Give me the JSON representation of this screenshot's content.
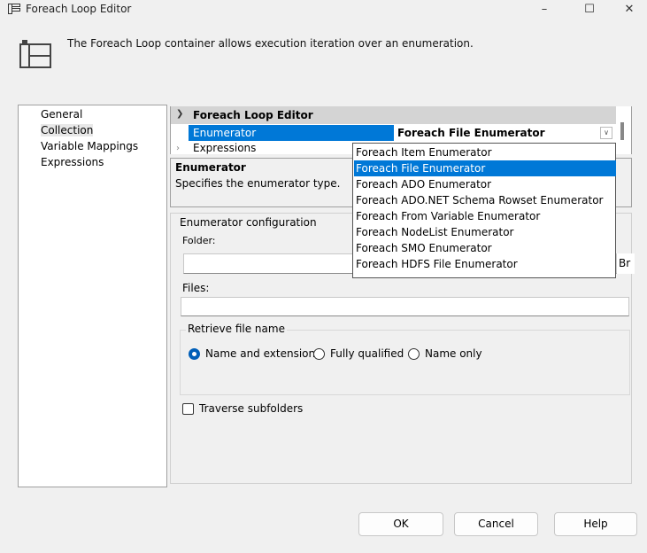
{
  "window": {
    "title": "Foreach Loop Editor",
    "minimize_glyph": "–",
    "maximize_glyph": "☐",
    "close_glyph": "✕"
  },
  "header": {
    "description": "The Foreach Loop container allows execution iteration over an enumeration."
  },
  "nav": {
    "items": [
      {
        "label": "General",
        "selected": false
      },
      {
        "label": "Collection",
        "selected": true
      },
      {
        "label": "Variable Mappings",
        "selected": false
      },
      {
        "label": "Expressions",
        "selected": false
      }
    ]
  },
  "property_grid": {
    "category": "Foreach Loop Editor",
    "rows": [
      {
        "name": "Enumerator",
        "value": "Foreach File Enumerator"
      },
      {
        "name": "Expressions",
        "value": ""
      }
    ]
  },
  "description_pane": {
    "title": "Enumerator",
    "text": "Specifies the enumerator type."
  },
  "config": {
    "title": "Enumerator configuration",
    "folder_label": "Folder:",
    "folder_value": "",
    "browse_label": "Br",
    "files_label": "Files:",
    "files_value": "",
    "retrieve_group_title": "Retrieve file name",
    "radio_options": [
      {
        "label": "Name and extension",
        "checked": true
      },
      {
        "label": "Fully qualified",
        "checked": false
      },
      {
        "label": "Name only",
        "checked": false
      }
    ],
    "traverse_label": "Traverse subfolders",
    "traverse_checked": false
  },
  "dropdown": {
    "items": [
      "Foreach Item Enumerator",
      "Foreach File Enumerator",
      "Foreach ADO Enumerator",
      "Foreach ADO.NET Schema Rowset Enumerator",
      "Foreach From Variable Enumerator",
      "Foreach NodeList Enumerator",
      "Foreach SMO Enumerator",
      "Foreach HDFS File Enumerator"
    ],
    "selected": "Foreach File Enumerator"
  },
  "buttons": {
    "ok": "OK",
    "cancel": "Cancel",
    "help": "Help"
  },
  "colors": {
    "selection": "#0078d7",
    "radio_checked": "#005fb8"
  }
}
